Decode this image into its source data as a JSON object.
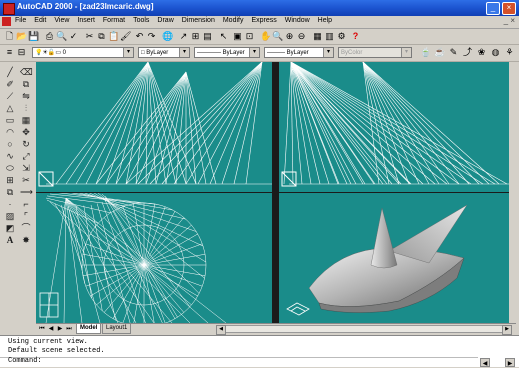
{
  "window": {
    "title": "AutoCAD 2000 - [zad23lmcaric.dwg]",
    "controls": [
      "minimize-icon",
      "maximize-icon",
      "close-icon"
    ]
  },
  "menu": {
    "items": [
      "File",
      "Edit",
      "View",
      "Insert",
      "Format",
      "Tools",
      "Draw",
      "Dimension",
      "Modify",
      "Express",
      "Window",
      "Help"
    ]
  },
  "toolbar": {
    "layer_value": "0",
    "color_value": "ByLayer",
    "linetype_value": "ByLayer",
    "lineweight_value": "ByLayer",
    "plotstyle_value": "ByColor",
    "help_symbol": "?"
  },
  "colors": {
    "viewport_bg": "#1a8c8a",
    "title_bar": "#1c54d0",
    "shade_viewport_bg": "#1a8c8a"
  },
  "layout_tabs": {
    "items": [
      "Model",
      "Layout1"
    ],
    "active": "Model"
  },
  "command": {
    "history": [
      "Using current view.",
      "Default scene selected."
    ],
    "prompt": "Command:"
  },
  "left_toolbar_icons": [
    "line-icon",
    "xline-icon",
    "pline-icon",
    "polygon-icon",
    "rectangle-icon",
    "arc-icon",
    "circle-icon",
    "spline-icon",
    "ellipse-icon",
    "block-icon",
    "insert-icon",
    "point-icon",
    "hatch-icon",
    "region-icon",
    "text-icon",
    "erase-icon",
    "copy-icon",
    "mirror-icon",
    "offset-icon",
    "array-icon",
    "move-icon",
    "rotate-icon",
    "scale-icon",
    "stretch-icon",
    "trim-icon",
    "extend-icon",
    "break-icon",
    "chamfer-icon",
    "fillet-icon",
    "explode-icon"
  ]
}
